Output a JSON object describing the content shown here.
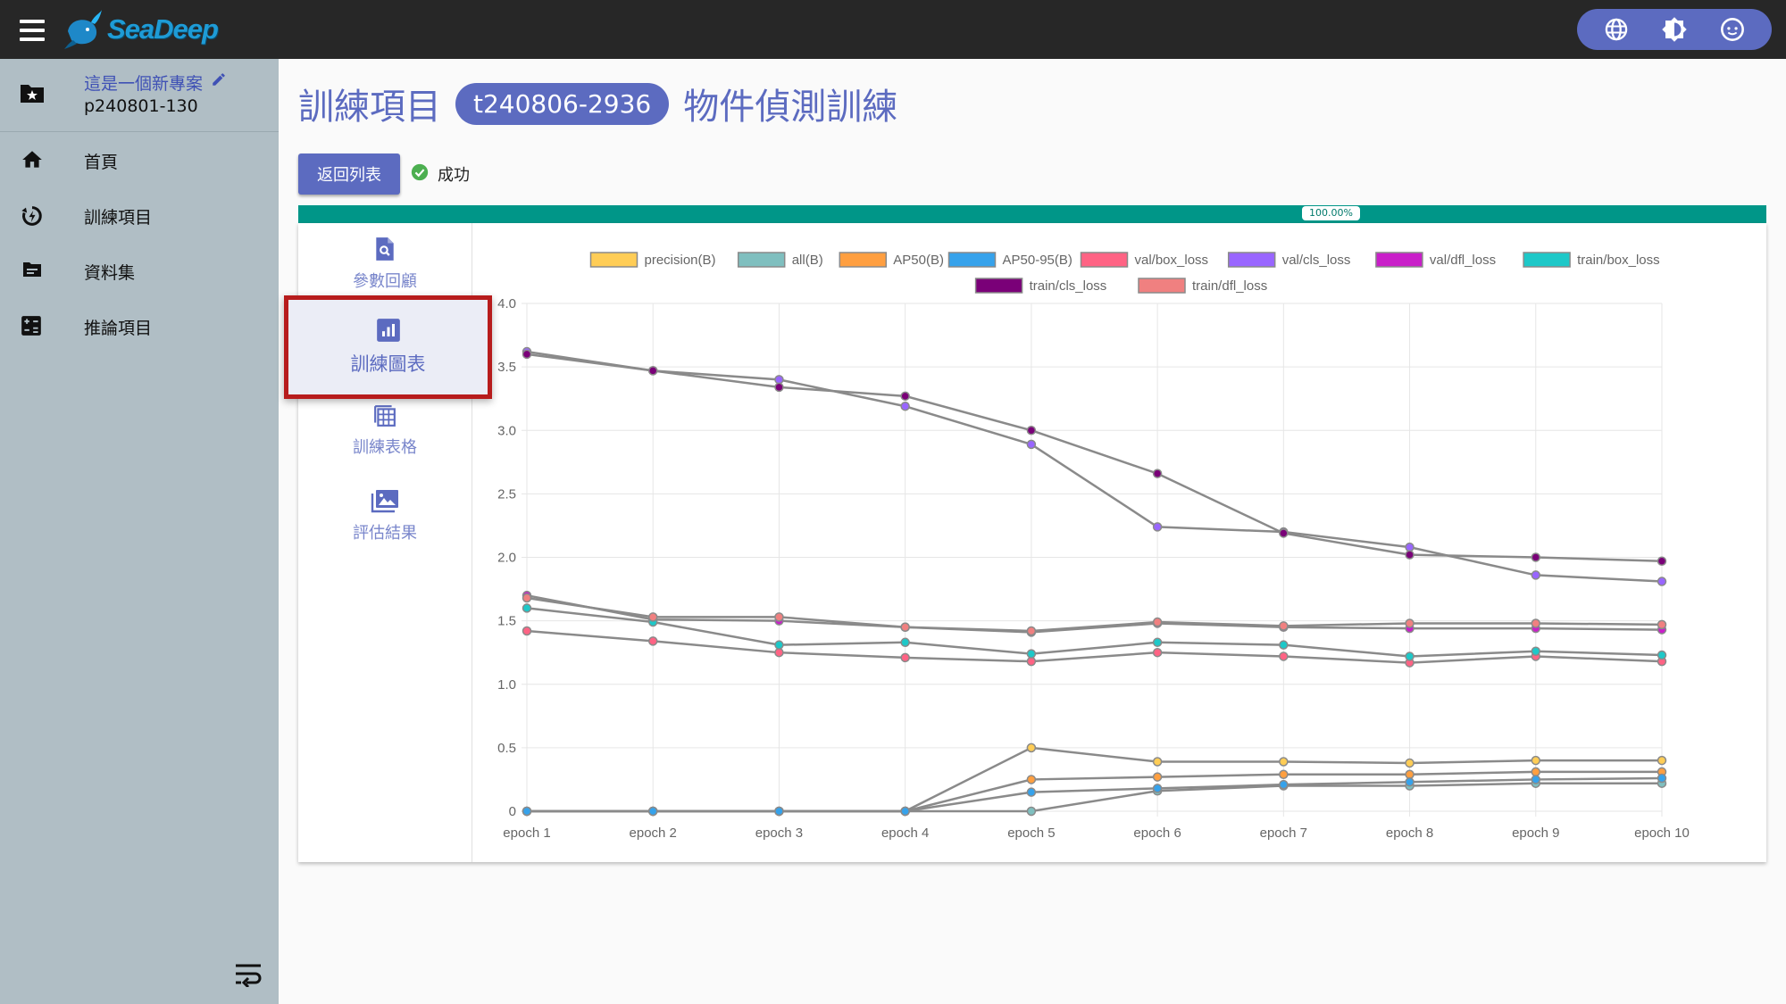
{
  "app": {
    "logo_text": "SeaDeep"
  },
  "header": {
    "actions": [
      "globe-icon",
      "brightness-icon",
      "account-icon"
    ]
  },
  "sidebar": {
    "project": {
      "name": "這是一個新專案",
      "code": "p240801-130"
    },
    "items": [
      {
        "label": "首頁",
        "icon": "home-icon"
      },
      {
        "label": "訓練項目",
        "icon": "training-icon"
      },
      {
        "label": "資料集",
        "icon": "dataset-icon"
      },
      {
        "label": "推論項目",
        "icon": "inference-icon"
      }
    ]
  },
  "page": {
    "title_prefix": "訓練項目",
    "badge": "t240806-2936",
    "title_suffix": "物件偵測訓練",
    "back_label": "返回列表",
    "status": "成功",
    "progress": "100.00%"
  },
  "tabs": [
    {
      "label": "參數回顧",
      "icon": "file-search-icon"
    },
    {
      "label": "訓練圖表",
      "icon": "bar-chart-icon",
      "active": true
    },
    {
      "label": "訓練表格",
      "icon": "table-icon"
    },
    {
      "label": "評估結果",
      "icon": "image-icon"
    }
  ],
  "colors": {
    "accent": "#5c6bc0",
    "progress": "#009688",
    "highlight": "#b71c1c",
    "line": "#8a8a8a"
  },
  "chart_data": {
    "type": "line",
    "categories": [
      "epoch 1",
      "epoch 2",
      "epoch 3",
      "epoch 4",
      "epoch 5",
      "epoch 6",
      "epoch 7",
      "epoch 8",
      "epoch 9",
      "epoch 10"
    ],
    "ylim": [
      0,
      4.0
    ],
    "yticks": [
      "0",
      "0.5",
      "1.0",
      "1.5",
      "2.0",
      "2.5",
      "3.0",
      "3.5",
      "4.0"
    ],
    "grid": true,
    "legend_position": "top",
    "series": [
      {
        "name": "precision(B)",
        "color": "#ffcd56",
        "values": [
          0,
          0,
          0,
          0,
          0.5,
          0.39,
          0.39,
          0.38,
          0.4,
          0.4
        ]
      },
      {
        "name": "all(B)",
        "color": "#7fbfbf",
        "values": [
          0,
          0,
          0,
          0,
          0,
          0.16,
          0.2,
          0.2,
          0.22,
          0.22
        ]
      },
      {
        "name": "AP50(B)",
        "color": "#ff9f40",
        "values": [
          0,
          0,
          0,
          0,
          0.25,
          0.27,
          0.29,
          0.29,
          0.31,
          0.31
        ]
      },
      {
        "name": "AP50-95(B)",
        "color": "#36a2eb",
        "values": [
          0,
          0,
          0,
          0,
          0.15,
          0.18,
          0.21,
          0.23,
          0.25,
          0.26
        ]
      },
      {
        "name": "val/box_loss",
        "color": "#ff6384",
        "values": [
          1.42,
          1.34,
          1.25,
          1.21,
          1.18,
          1.25,
          1.22,
          1.17,
          1.22,
          1.18
        ]
      },
      {
        "name": "val/cls_loss",
        "color": "#9966ff",
        "values": [
          3.62,
          3.47,
          3.4,
          3.19,
          2.89,
          2.24,
          2.2,
          2.08,
          1.86,
          1.81
        ]
      },
      {
        "name": "val/dfl_loss",
        "color": "#c91fc9",
        "values": [
          1.7,
          1.51,
          1.5,
          1.45,
          1.41,
          1.48,
          1.45,
          1.44,
          1.44,
          1.43
        ]
      },
      {
        "name": "train/box_loss",
        "color": "#1ec8c8",
        "values": [
          1.6,
          1.49,
          1.31,
          1.33,
          1.24,
          1.33,
          1.31,
          1.22,
          1.26,
          1.23
        ]
      },
      {
        "name": "train/cls_loss",
        "color": "#7a0078",
        "values": [
          3.6,
          3.47,
          3.34,
          3.27,
          3.0,
          2.66,
          2.19,
          2.02,
          2.0,
          1.97
        ]
      },
      {
        "name": "train/dfl_loss",
        "color": "#f08080",
        "values": [
          1.68,
          1.53,
          1.53,
          1.45,
          1.42,
          1.49,
          1.46,
          1.48,
          1.48,
          1.47
        ]
      }
    ]
  }
}
